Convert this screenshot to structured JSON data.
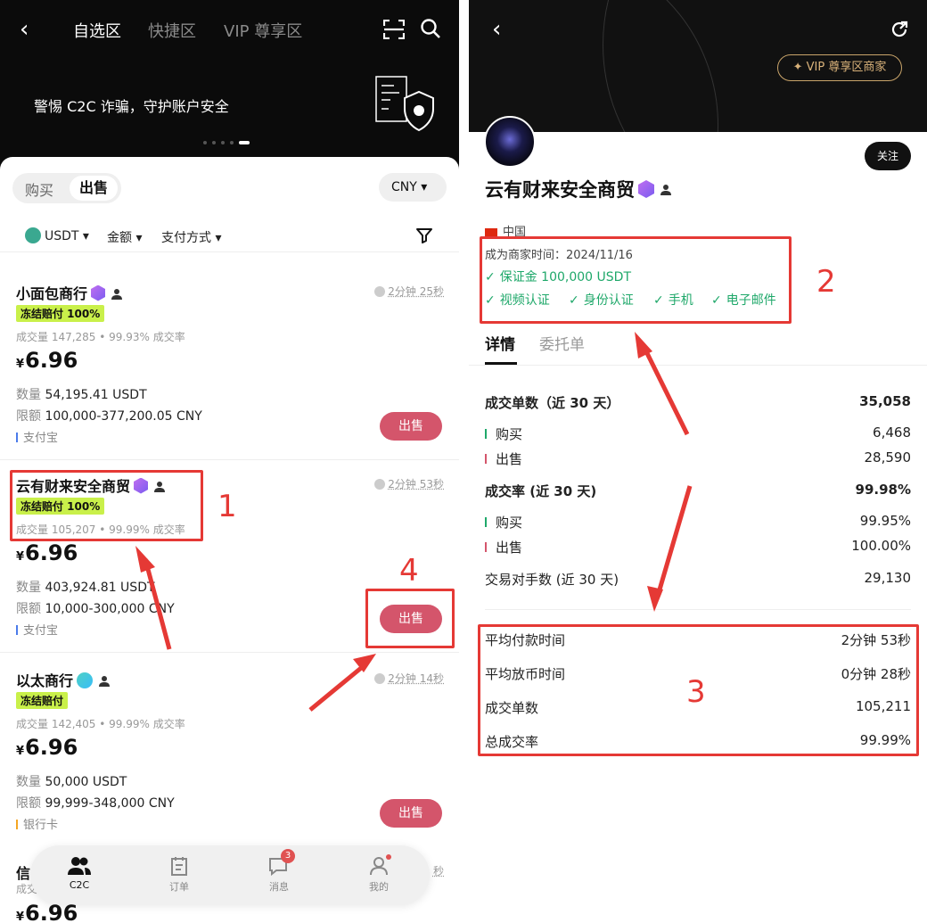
{
  "left": {
    "nav": {
      "tabs": [
        "自选区",
        "快捷区",
        "VIP 尊享区"
      ],
      "active": 0
    },
    "banner": {
      "text": "警惕 C2C 诈骗，守护账户安全"
    },
    "segment": {
      "buy": "购买",
      "sell": "出售"
    },
    "currency": "CNY",
    "filters": {
      "coin": "USDT",
      "amount": "金额",
      "payment": "支付方式"
    },
    "cards": [
      {
        "name": "小面包商行",
        "timer": "2分钟 25秒",
        "tag": "冻结赔付 100%",
        "stat": "成交量 147,285 • 99.93% 成交率",
        "currency_symbol": "¥",
        "price": "6.96",
        "qty_label": "数量",
        "qty": "54,195.41 USDT",
        "limit_label": "限额",
        "limit": "100,000-377,200.05 CNY",
        "payment": "支付宝",
        "button": "出售"
      },
      {
        "name": "云有财来安全商贸",
        "timer": "2分钟 53秒",
        "tag": "冻结赔付 100%",
        "stat": "成交量 105,207 • 99.99% 成交率",
        "currency_symbol": "¥",
        "price": "6.96",
        "qty_label": "数量",
        "qty": "403,924.81 USDT",
        "limit_label": "限额",
        "limit": "10,000-300,000 CNY",
        "payment": "支付宝",
        "button": "出售"
      },
      {
        "name": "以太商行",
        "timer": "2分钟 14秒",
        "tag": "冻结赔付",
        "stat": "成交量 142,405 • 99.99% 成交率",
        "currency_symbol": "¥",
        "price": "6.96",
        "qty_label": "数量",
        "qty": "50,000 USDT",
        "limit_label": "限额",
        "limit": "99,999-348,000 CNY",
        "payment": "银行卡",
        "button": "出售"
      },
      {
        "name": "信",
        "timer": "秒",
        "stat": "成交",
        "currency_symbol": "¥",
        "price": "6.96"
      }
    ],
    "bottom_nav": [
      {
        "label": "C2C"
      },
      {
        "label": "订单"
      },
      {
        "label": "消息",
        "badge": "3"
      },
      {
        "label": "我的"
      }
    ]
  },
  "right": {
    "vip_badge": "VIP 尊享区商家",
    "follow": "关注",
    "merchant_name": "云有财来安全商贸",
    "country": "中国",
    "since": "成为商家时间：2024/11/16",
    "deposit": "保证金 100,000 USDT",
    "verifications": [
      "视频认证",
      "身份认证",
      "手机",
      "电子邮件"
    ],
    "tabs": [
      "详情",
      "委托单"
    ],
    "stats": [
      {
        "label": "成交单数（近 30 天）",
        "value": "35,058"
      },
      {
        "label": "购买",
        "value": "6,468"
      },
      {
        "label": "出售",
        "value": "28,590"
      },
      {
        "label": "成交率 (近 30 天)",
        "value": "99.98%"
      },
      {
        "label": "购买",
        "value": "99.95%"
      },
      {
        "label": "出售",
        "value": "100.00%"
      },
      {
        "label": "交易对手数 (近 30 天)",
        "value": "29,130"
      }
    ],
    "metrics": [
      {
        "label": "平均付款时间",
        "value": "2分钟 53秒"
      },
      {
        "label": "平均放币时间",
        "value": "0分钟 28秒"
      },
      {
        "label": "成交单数",
        "value": "105,211"
      },
      {
        "label": "总成交率",
        "value": "99.99%"
      }
    ]
  },
  "annotations": [
    "1",
    "2",
    "3",
    "4"
  ],
  "colors": {
    "sell": "#d4556b",
    "tag": "#c9f04a",
    "verified": "#1fa86a",
    "annotation": "#e53935",
    "vip_gold": "#d9b27a"
  }
}
